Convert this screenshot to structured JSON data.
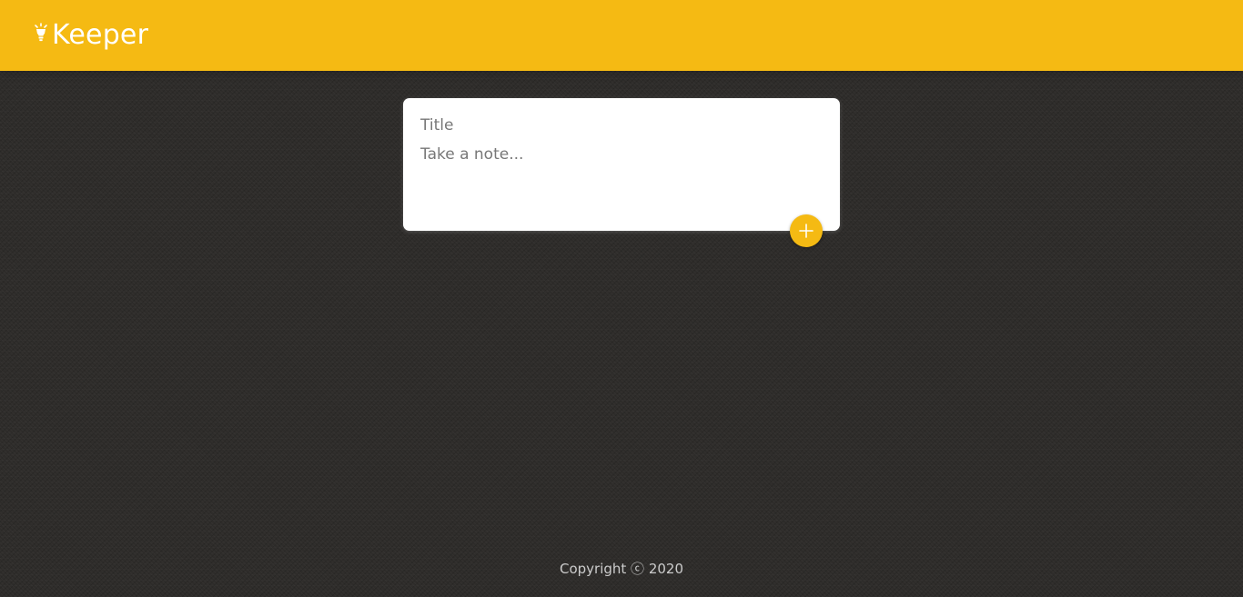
{
  "header": {
    "brand_title": "Keeper",
    "brand_icon": "lightbulb-icon",
    "accent_color": "#f5ba13"
  },
  "note_form": {
    "title_placeholder": "Title",
    "content_placeholder": "Take a note...",
    "add_button_icon": "plus-icon"
  },
  "footer": {
    "copyright": "Copyright ⓒ 2020"
  },
  "colors": {
    "header_background": "#f5ba13",
    "page_background": "#2e2c2a",
    "card_background": "#ffffff",
    "footer_text": "#cccccc"
  }
}
